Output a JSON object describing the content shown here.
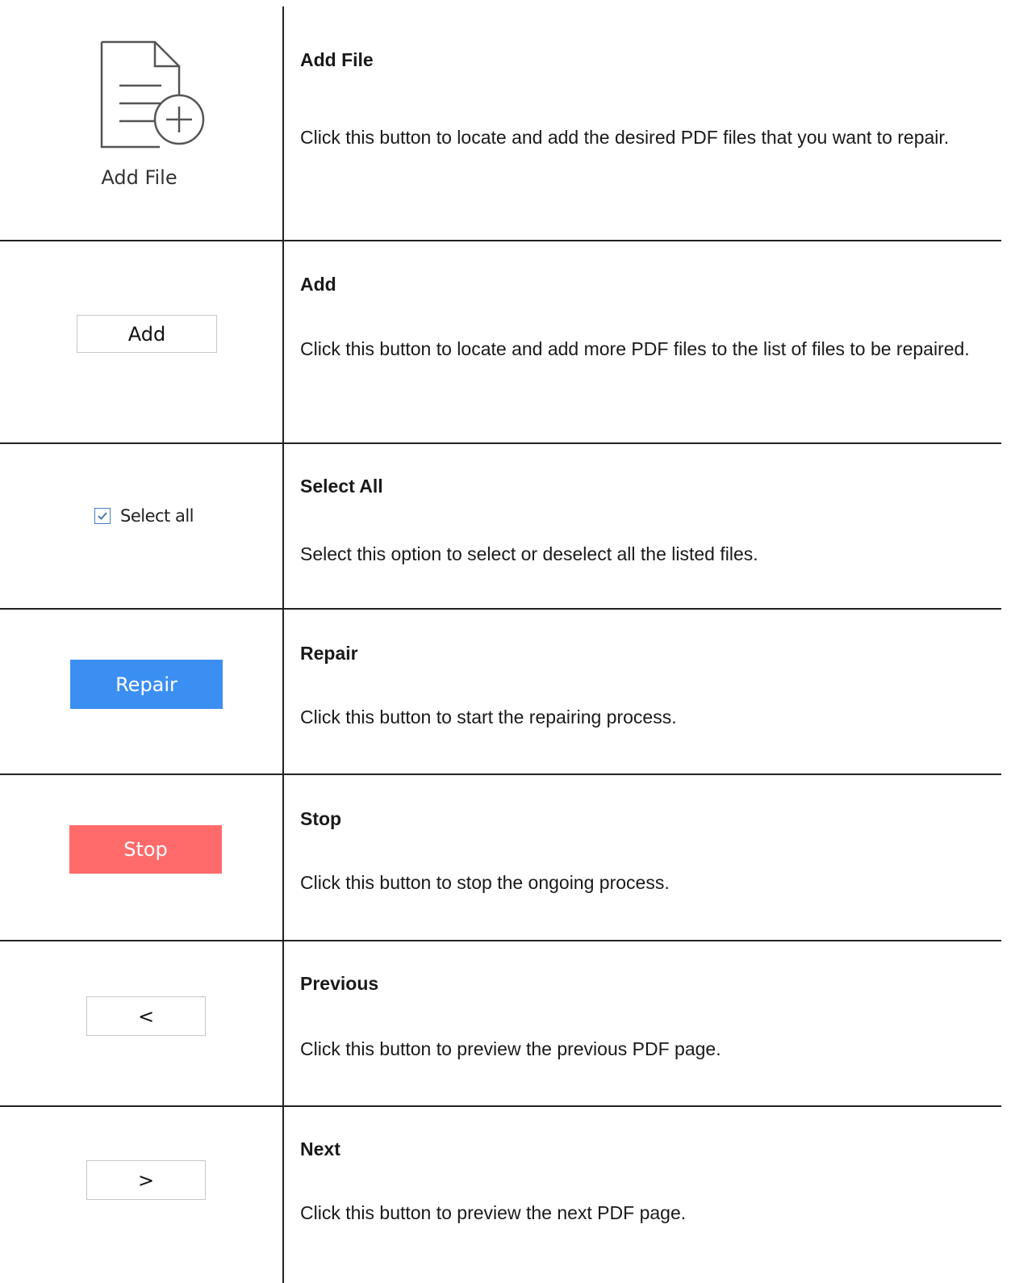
{
  "rows": [
    {
      "title": "Add File",
      "description": "Click this button to locate and add the desired PDF files that you want to repair.",
      "control_label": "Add File",
      "icon": "add-file-icon"
    },
    {
      "title": "Add",
      "description": "Click this button to locate and add more PDF files to the list of files to be repaired.",
      "control_label": "Add"
    },
    {
      "title": "Select All",
      "description": "Select this option to select or deselect all the listed files.",
      "control_label": "Select all",
      "checked": true
    },
    {
      "title": "Repair",
      "description": "Click this button to start the repairing process.",
      "control_label": "Repair",
      "color": "#3b8ff3"
    },
    {
      "title": "Stop",
      "description": "Click this button to stop the ongoing process.",
      "control_label": "Stop",
      "color": "#ff6b6b"
    },
    {
      "title": "Previous",
      "description": "Click this button to preview the previous PDF page.",
      "control_label": "<"
    },
    {
      "title": "Next",
      "description": "Click this button to preview the next PDF page.",
      "control_label": ">"
    }
  ]
}
